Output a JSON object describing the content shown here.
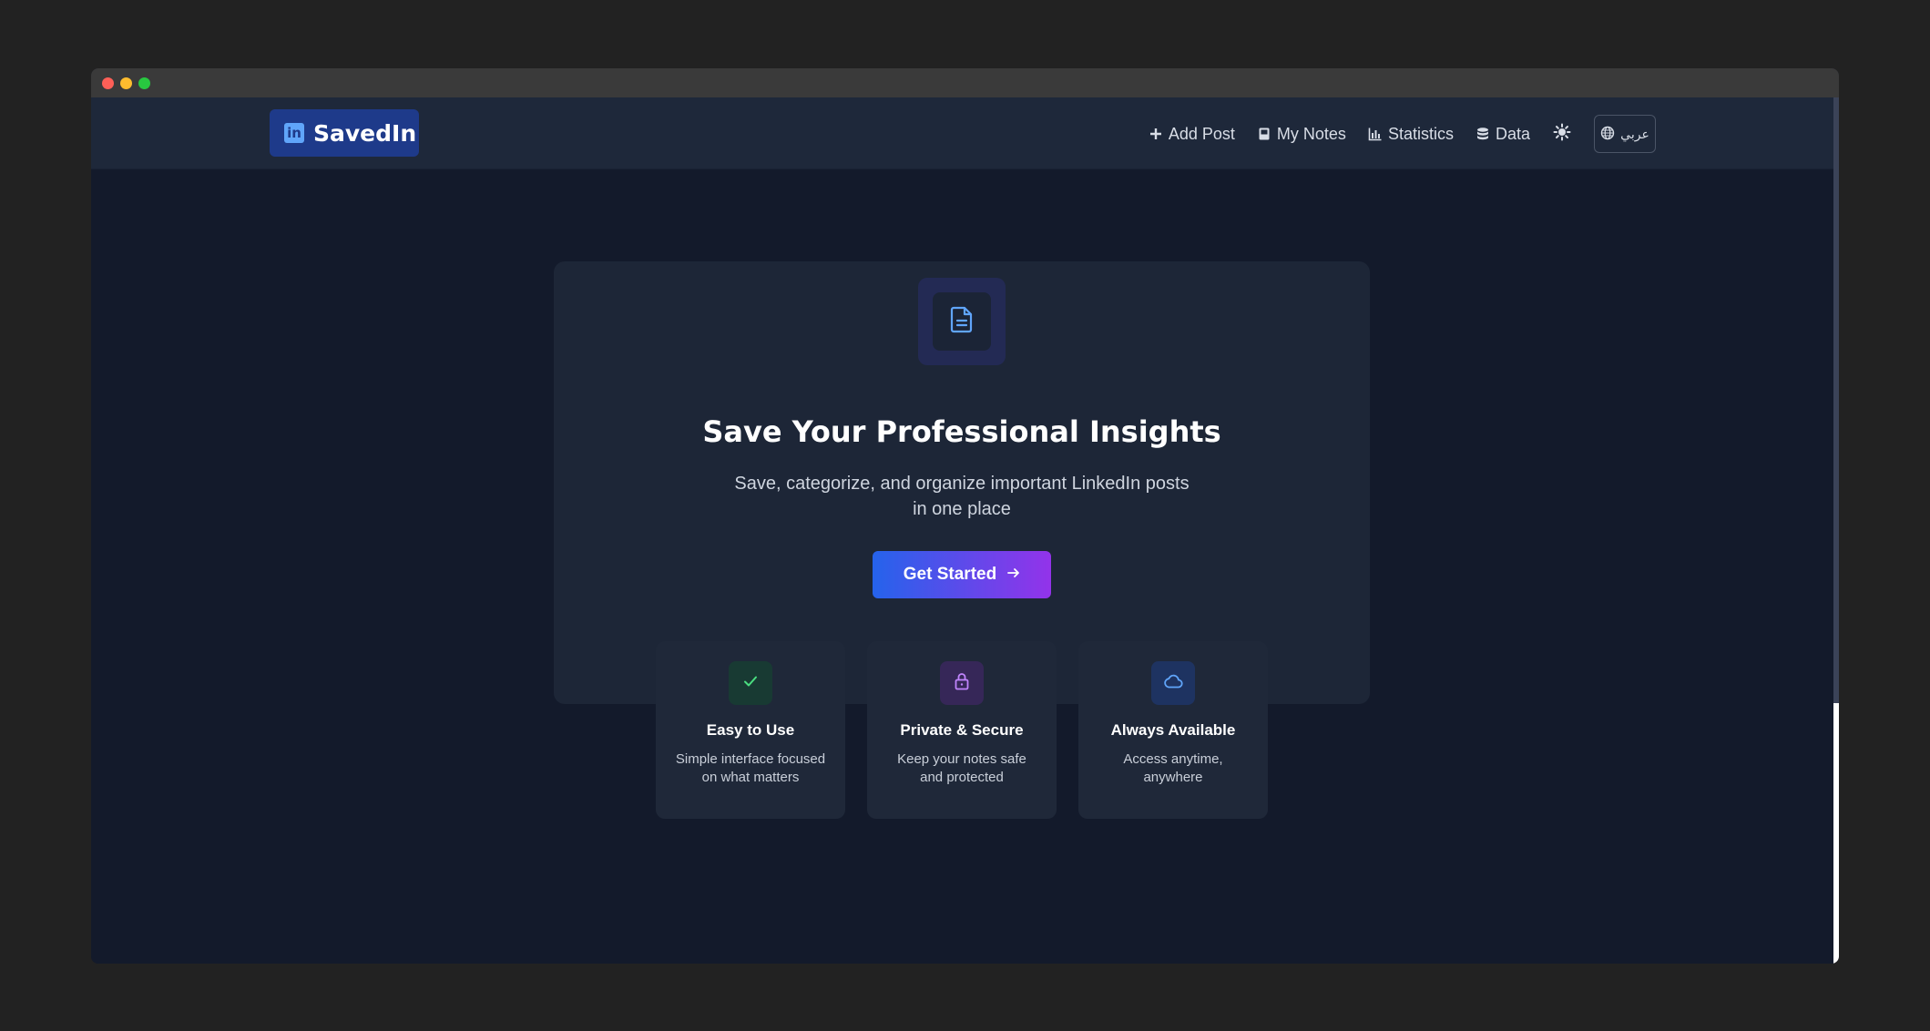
{
  "app": {
    "brand": "SavedIn",
    "brand_badge": "in"
  },
  "nav": {
    "add_post": "Add Post",
    "my_notes": "My Notes",
    "statistics": "Statistics",
    "data": "Data",
    "language": "عربي"
  },
  "hero": {
    "title": "Save Your Professional Insights",
    "subtitle": "Save, categorize, and organize important LinkedIn posts in one place",
    "cta": "Get Started"
  },
  "features": [
    {
      "title": "Easy to Use",
      "desc": "Simple interface focused on what matters",
      "icon": "check-icon",
      "color": "#4ade80"
    },
    {
      "title": "Private & Secure",
      "desc": "Keep your notes safe and protected",
      "icon": "lock-icon",
      "color": "#c084fc"
    },
    {
      "title": "Always Available",
      "desc": "Access anytime, anywhere",
      "icon": "cloud-icon",
      "color": "#60a5fa"
    }
  ],
  "colors": {
    "accent_blue": "#2563eb",
    "accent_purple": "#9333ea",
    "brand_bg": "#1e3a8a",
    "page_bg": "#131a2b"
  }
}
